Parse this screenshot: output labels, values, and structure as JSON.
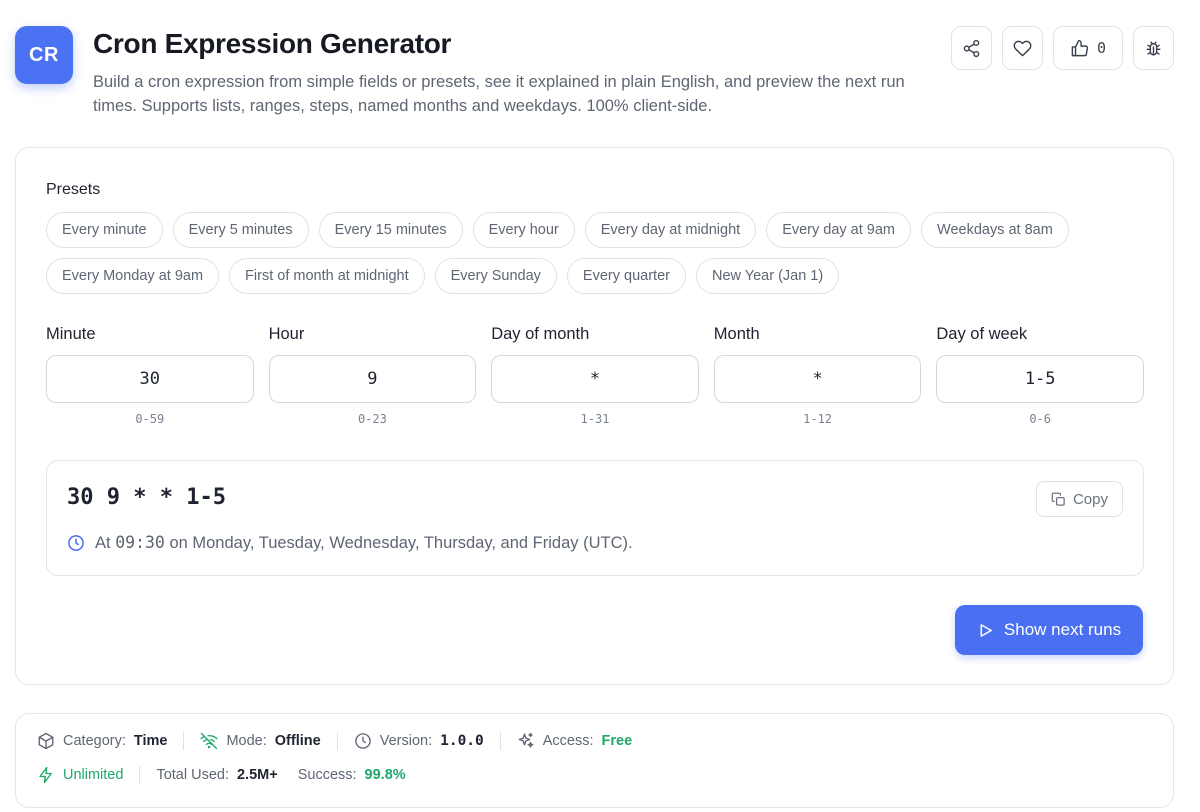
{
  "header": {
    "logo_text": "CR",
    "title": "Cron Expression Generator",
    "subtitle": "Build a cron expression from simple fields or presets, see it explained in plain English, and preview the next run times. Supports lists, ranges, steps, named months and weekdays. 100% client-side.",
    "like_count": "0",
    "icons": [
      "share-icon",
      "heart-icon",
      "thumbs-up-icon",
      "bug-icon"
    ]
  },
  "presets": {
    "label": "Presets",
    "items": [
      "Every minute",
      "Every 5 minutes",
      "Every 15 minutes",
      "Every hour",
      "Every day at midnight",
      "Every day at 9am",
      "Weekdays at 8am",
      "Every Monday at 9am",
      "First of month at midnight",
      "Every Sunday",
      "Every quarter",
      "New Year (Jan 1)"
    ]
  },
  "fields": [
    {
      "label": "Minute",
      "value": "30",
      "hint": "0-59"
    },
    {
      "label": "Hour",
      "value": "9",
      "hint": "0-23"
    },
    {
      "label": "Day of month",
      "value": "*",
      "hint": "1-31"
    },
    {
      "label": "Month",
      "value": "*",
      "hint": "1-12"
    },
    {
      "label": "Day of week",
      "value": "1-5",
      "hint": "0-6"
    }
  ],
  "result": {
    "expression": "30 9 * * 1-5",
    "copy_label": "Copy",
    "explanation_prefix": "At ",
    "explanation_time": "09:30",
    "explanation_rest": " on Monday, Tuesday, Wednesday, Thursday, and Friday (UTC)."
  },
  "run_button": "Show next runs",
  "info": {
    "category_label": "Category:",
    "category_value": "Time",
    "mode_label": "Mode:",
    "mode_value": "Offline",
    "version_label": "Version:",
    "version_value": "1.0.0",
    "access_label": "Access:",
    "access_value": "Free",
    "unlimited_label": "Unlimited",
    "total_label": "Total Used:",
    "total_value": "2.5M+",
    "success_label": "Success:",
    "success_value": "99.8%"
  },
  "colors": {
    "accent": "#4a6ff0",
    "success": "#1ea86b"
  }
}
